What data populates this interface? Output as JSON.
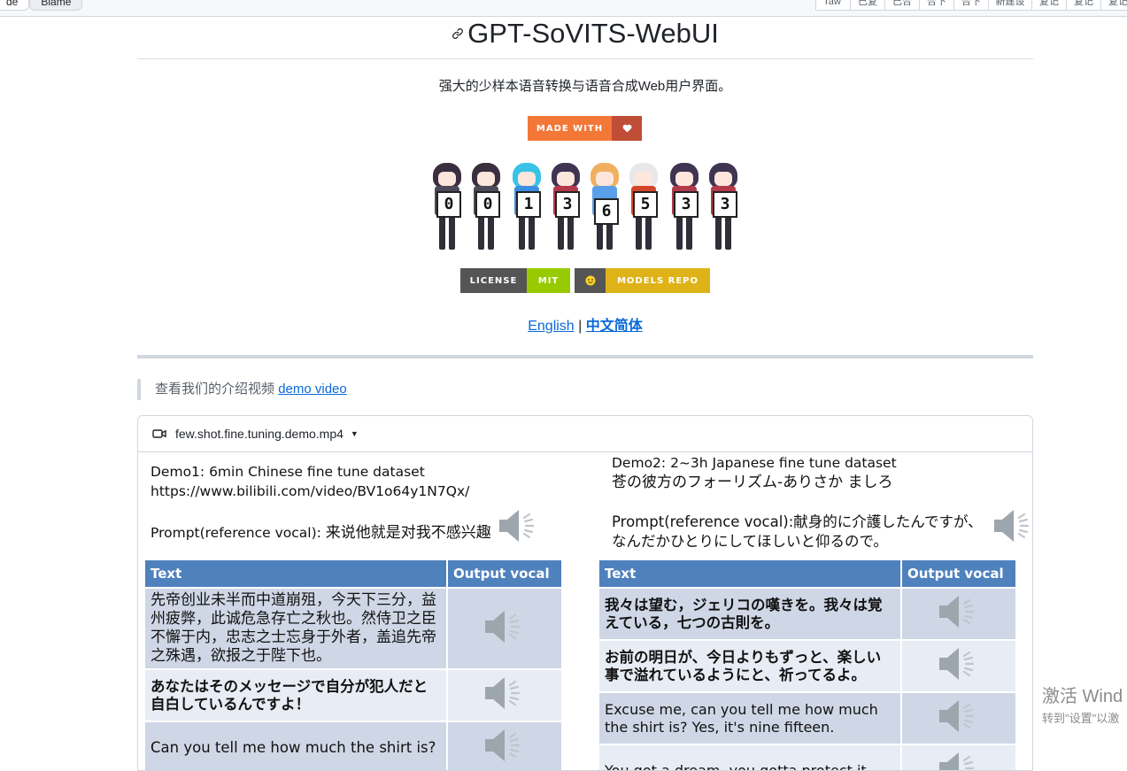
{
  "toolbar": {
    "left_buttons": [
      "de",
      "Blame"
    ],
    "right_buttons": [
      "raw",
      "已复",
      "已合",
      "合下",
      "合下",
      "新建设",
      "复记",
      "复记",
      "复记"
    ]
  },
  "header": {
    "anchor_icon": "link-icon",
    "title": "GPT-SoVITS-WebUI"
  },
  "subtitle": "强大的少样本语音转换与语音合成Web用户界面。",
  "badges": {
    "made_with": {
      "label": "MADE WITH",
      "icon": "heart-icon",
      "label_color": "#f37737",
      "icon_color": "#c04d35"
    },
    "license": {
      "label": "LICENSE",
      "value": "MIT",
      "label_color": "#555555",
      "value_color": "#97ca00"
    },
    "models": {
      "icon": "hugging-face-icon",
      "label": "MODELS REPO",
      "icon_bg": "#555555",
      "label_color": "#dfb317"
    }
  },
  "visitor_counter": {
    "digits": [
      "0",
      "0",
      "1",
      "3",
      "6",
      "5",
      "3",
      "3"
    ]
  },
  "languages": {
    "english": "English",
    "separator": "|",
    "chinese": "中文简体"
  },
  "intro": {
    "text": "查看我们的介绍视频",
    "link": "demo video"
  },
  "video": {
    "icon": "video-icon",
    "filename": "few.shot.fine.tuning.demo.mp4",
    "dropdown_icon": "caret-down-icon"
  },
  "demo1": {
    "title": "Demo1: 6min Chinese fine tune dataset",
    "url": "https://www.bilibili.com/video/BV1o64y1N7Qx/",
    "prompt_label": "Prompt(reference vocal): ",
    "prompt_text": "来说他就是对我不感兴趣",
    "headers": [
      "Text",
      "Output vocal"
    ],
    "rows": [
      "先帝创业未半而中道崩殂，今天下三分，益州疲弊，此诚危急存亡之秋也。然侍卫之臣不懈于内，忠志之士忘身于外者，盖追先帝之殊遇，欲报之于陛下也。",
      "あなたはそのメッセージで自分が犯人だと自白しているんですよ！",
      "Can you tell me how much the shirt is?"
    ]
  },
  "demo2": {
    "title": "Demo2: 2~3h Japanese fine tune dataset",
    "subtitle": "苍の彼方のフォーリズム-ありさか ましろ",
    "prompt_label": "Prompt(reference vocal):",
    "prompt_text": "献身的に介護したんですが、なんだかひとりにしてほしいと仰るので。",
    "headers": [
      "Text",
      "Output vocal"
    ],
    "rows": [
      "我々は望む，ジェリコの嘆きを。我々は覚えている，七つの古則を。",
      "お前の明日が、今日よりもずっと、楽しい事で溢れているようにと、祈ってるよ。",
      "Excuse me, can you tell me how much the shirt is? Yes, it's nine fifteen.",
      "You got a dream, you gotta protect it."
    ]
  },
  "watermark": {
    "line1": "激活 Wind",
    "line2": "转到\"设置\"以激"
  }
}
